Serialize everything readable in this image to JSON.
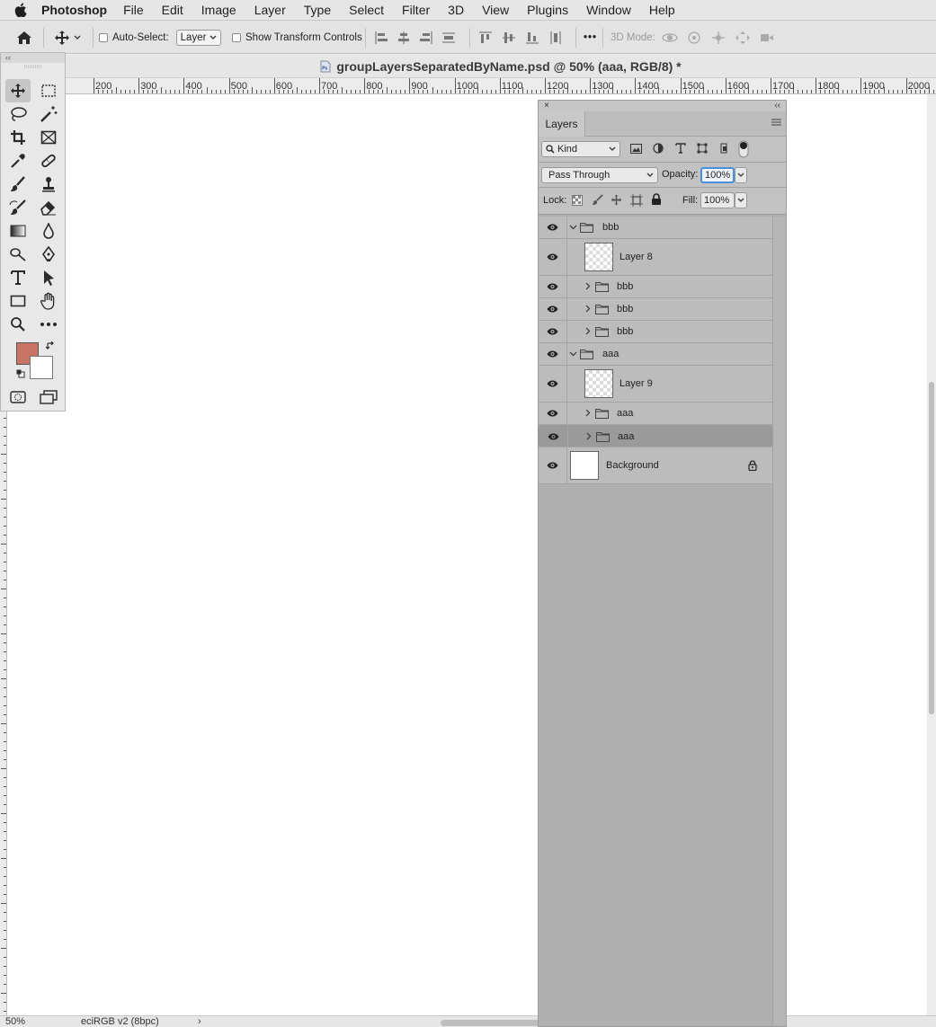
{
  "menubar": {
    "app_name": "Photoshop",
    "items": [
      "File",
      "Edit",
      "Image",
      "Layer",
      "Type",
      "Select",
      "Filter",
      "3D",
      "View",
      "Plugins",
      "Window",
      "Help"
    ]
  },
  "options_bar": {
    "auto_select_label": "Auto-Select:",
    "auto_select_value": "Layer",
    "show_transform_label": "Show Transform Controls",
    "mode_3d_label": "3D Mode:",
    "more_label": "•••"
  },
  "document": {
    "title": "groupLayersSeparatedByName.psd @ 50% (aaa, RGB/8) *",
    "file_badge": "Ps"
  },
  "ruler": {
    "labels": [
      "200",
      "300",
      "400",
      "500",
      "600",
      "700",
      "800",
      "900",
      "1000",
      "1100",
      "1200",
      "1300",
      "1400",
      "1500",
      "1600",
      "1700",
      "1800",
      "1900",
      "2000"
    ]
  },
  "status": {
    "zoom": "50%",
    "profile": "eciRGB v2 (8bpc)",
    "arrow": "›"
  },
  "tools": {
    "collapse": "‹‹",
    "foreground_color": "#c87566",
    "background_color": "#ffffff"
  },
  "layers_panel": {
    "close": "×",
    "collapse": "‹‹",
    "tab_label": "Layers",
    "filter_kind": "Kind",
    "blend_mode": "Pass Through",
    "opacity_label": "Opacity:",
    "opacity_value": "100%",
    "lock_label": "Lock:",
    "fill_label": "Fill:",
    "fill_value": "100%",
    "layers": [
      {
        "name": "bbb",
        "kind": "group",
        "expanded": true,
        "indent": 0
      },
      {
        "name": "Layer 8",
        "kind": "pixel",
        "indent": 1
      },
      {
        "name": "bbb",
        "kind": "group",
        "expanded": false,
        "indent": 1
      },
      {
        "name": "bbb",
        "kind": "group",
        "expanded": false,
        "indent": 1
      },
      {
        "name": "bbb",
        "kind": "group",
        "expanded": false,
        "indent": 1
      },
      {
        "name": "aaa",
        "kind": "group",
        "expanded": true,
        "indent": 0
      },
      {
        "name": "Layer 9",
        "kind": "pixel",
        "indent": 1
      },
      {
        "name": "aaa",
        "kind": "group",
        "expanded": false,
        "indent": 1
      },
      {
        "name": "aaa",
        "kind": "group",
        "expanded": false,
        "indent": 1,
        "selected": true
      },
      {
        "name": "Background",
        "kind": "background",
        "locked": true,
        "indent": 0
      }
    ]
  }
}
